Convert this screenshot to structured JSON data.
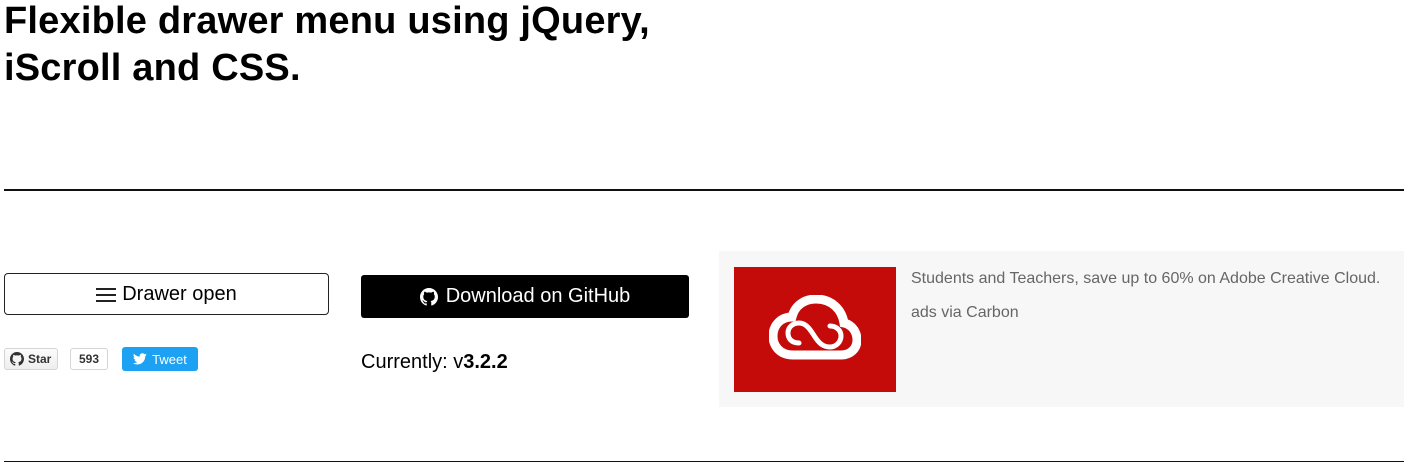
{
  "page": {
    "title": "Flexible drawer menu using jQuery, iScroll and CSS."
  },
  "actions": {
    "drawer_open_label": "Drawer open",
    "download_label": "Download on GitHub",
    "current_prefix": "Currently: v",
    "current_version": "3.2.2"
  },
  "social": {
    "star_label": "Star",
    "star_count": "593",
    "tweet_label": "Tweet"
  },
  "ad": {
    "text": "Students and Teachers, save up to 60% on Adobe Creative Cloud.",
    "via": "ads via Carbon",
    "image_color": "#c50a0a"
  },
  "icons": {
    "menu": "hamburger-icon",
    "github": "github-octocat-icon",
    "twitter": "twitter-bird-icon",
    "ad_logo": "creative-cloud-icon"
  }
}
